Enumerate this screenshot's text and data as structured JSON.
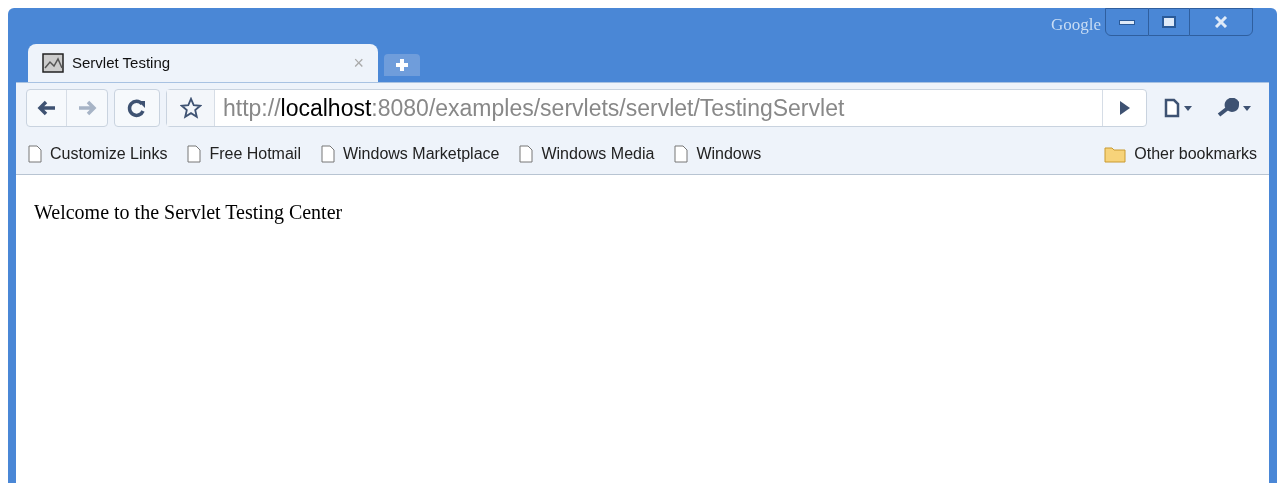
{
  "window": {
    "brand": "Google"
  },
  "tabs": [
    {
      "title": "Servlet Testing",
      "close": "×",
      "selected": true
    }
  ],
  "address_bar": {
    "scheme": "http://",
    "host": "localhost",
    "path": ":8080/examples/servlets/servlet/TestingServlet"
  },
  "bookmarks": [
    {
      "label": "Customize Links"
    },
    {
      "label": "Free Hotmail"
    },
    {
      "label": "Windows Marketplace"
    },
    {
      "label": "Windows Media"
    },
    {
      "label": "Windows"
    }
  ],
  "other_bookmarks": "Other bookmarks",
  "page": {
    "text": "Welcome to the Servlet Testing Center"
  }
}
